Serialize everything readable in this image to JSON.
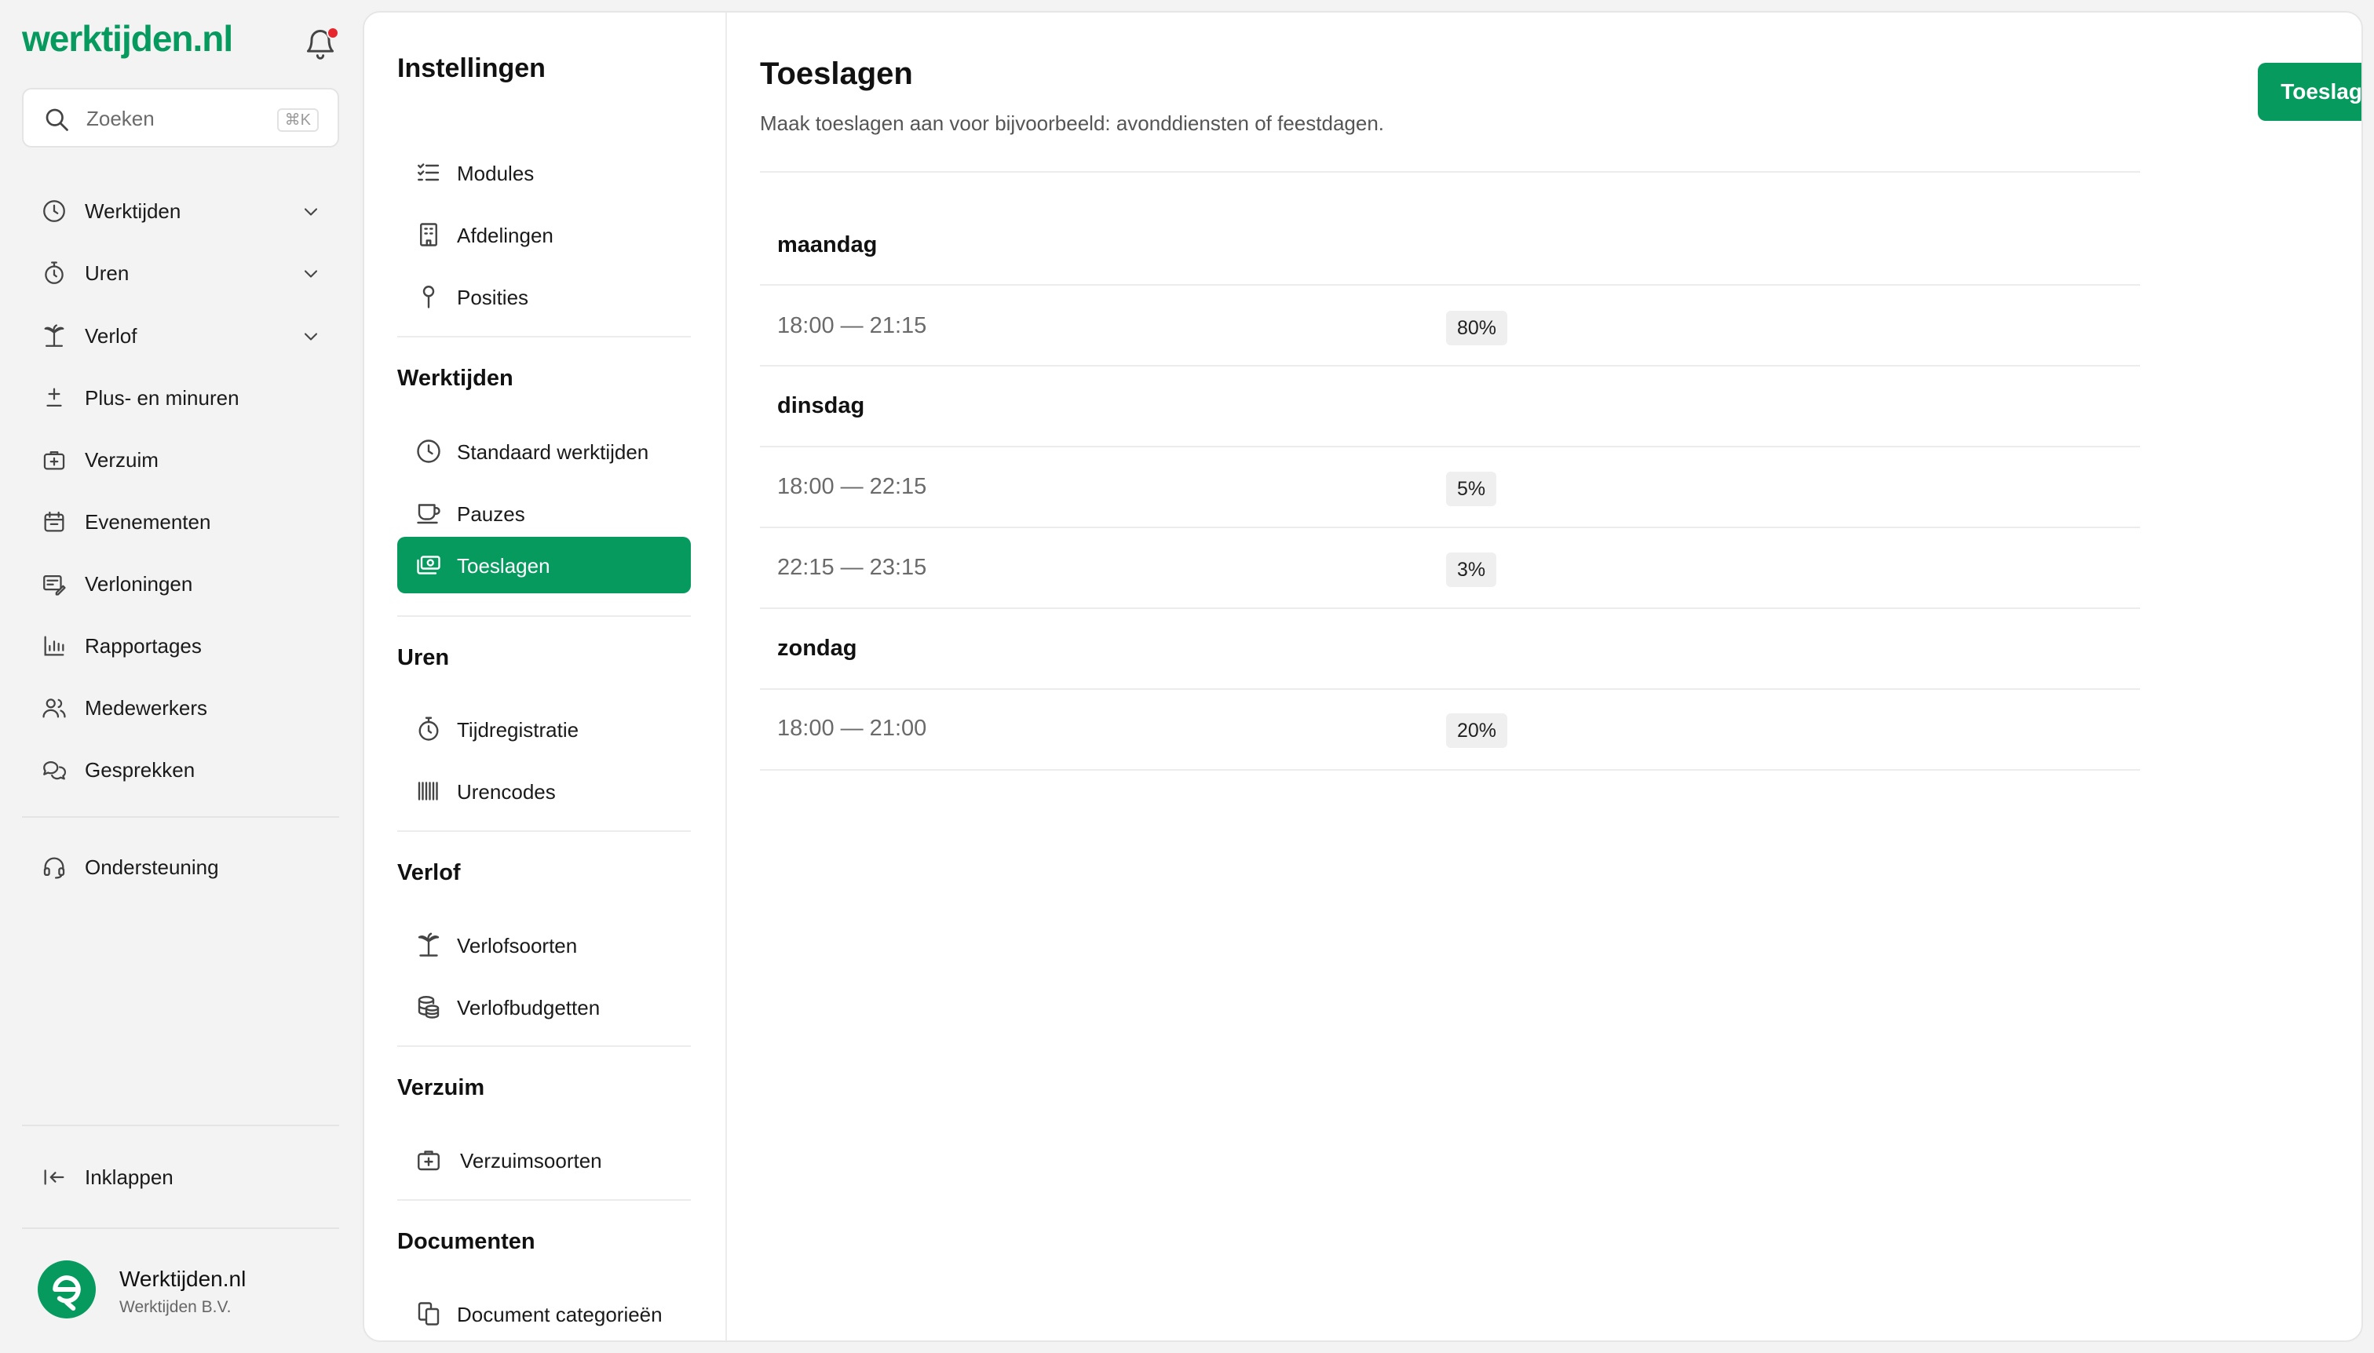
{
  "app": {
    "logo_text": "werktijden.nl",
    "brand_color": "#069a5f",
    "accent_danger": "#e5262d"
  },
  "sidebar": {
    "search_placeholder": "Zoeken",
    "search_shortcut": "⌘K",
    "items": [
      {
        "label": "Werktijden",
        "icon": "clock-icon",
        "expandable": true
      },
      {
        "label": "Uren",
        "icon": "stopwatch-icon",
        "expandable": true
      },
      {
        "label": "Verlof",
        "icon": "palm-tree-icon",
        "expandable": true
      },
      {
        "label": "Plus- en minuren",
        "icon": "plus-minus-icon",
        "expandable": false
      },
      {
        "label": "Verzuim",
        "icon": "medical-kit-icon",
        "expandable": false
      },
      {
        "label": "Evenementen",
        "icon": "calendar-icon",
        "expandable": false
      },
      {
        "label": "Verloningen",
        "icon": "payslip-icon",
        "expandable": false
      },
      {
        "label": "Rapportages",
        "icon": "bar-chart-icon",
        "expandable": false
      },
      {
        "label": "Medewerkers",
        "icon": "users-icon",
        "expandable": false
      },
      {
        "label": "Gesprekken",
        "icon": "chat-icon",
        "expandable": false
      }
    ],
    "support_label": "Ondersteuning",
    "collapse_label": "Inklappen",
    "account": {
      "name": "Werktijden.nl",
      "company": "Werktijden B.V."
    }
  },
  "settings": {
    "title": "Instellingen",
    "general": [
      {
        "label": "Modules",
        "icon": "list-check-icon"
      },
      {
        "label": "Afdelingen",
        "icon": "building-icon"
      },
      {
        "label": "Posities",
        "icon": "pin-icon"
      }
    ],
    "sections": [
      {
        "title": "Werktijden",
        "items": [
          {
            "label": "Standaard werktijden",
            "icon": "clock-icon"
          },
          {
            "label": "Pauzes",
            "icon": "coffee-cup-icon"
          },
          {
            "label": "Toeslagen",
            "icon": "money-icon",
            "active": true
          }
        ]
      },
      {
        "title": "Uren",
        "items": [
          {
            "label": "Tijdregistratie",
            "icon": "stopwatch-icon"
          },
          {
            "label": "Urencodes",
            "icon": "barcode-icon"
          }
        ]
      },
      {
        "title": "Verlof",
        "items": [
          {
            "label": "Verlofsoorten",
            "icon": "palm-tree-icon"
          },
          {
            "label": "Verlofbudgetten",
            "icon": "coins-icon"
          }
        ]
      },
      {
        "title": "Verzuim",
        "items": [
          {
            "label": "Verzuimsoorten",
            "icon": "medical-kit-icon"
          }
        ]
      },
      {
        "title": "Documenten",
        "items": [
          {
            "label": "Document categorieën",
            "icon": "documents-icon"
          }
        ]
      }
    ]
  },
  "content": {
    "title": "Toeslagen",
    "description": "Maak toeslagen aan voor bijvoorbeeld: avonddiensten of feestdagen.",
    "add_button": "Toeslag toevoegen",
    "days": [
      {
        "name": "maandag",
        "entries": [
          {
            "range": "18:00 — 21:15",
            "pct": "80%"
          }
        ]
      },
      {
        "name": "dinsdag",
        "entries": [
          {
            "range": "18:00 — 22:15",
            "pct": "5%"
          },
          {
            "range": "22:15 — 23:15",
            "pct": "3%"
          }
        ]
      },
      {
        "name": "zondag",
        "entries": [
          {
            "range": "18:00 — 21:00",
            "pct": "20%"
          }
        ]
      }
    ]
  }
}
